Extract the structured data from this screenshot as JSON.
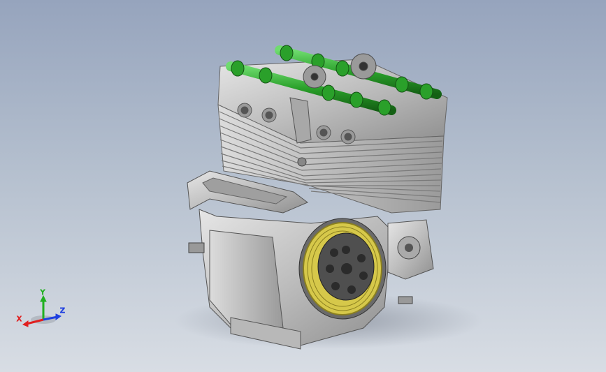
{
  "triad": {
    "x_label": "X",
    "y_label": "Y",
    "z_label": "Z",
    "colors": {
      "x": "#e02020",
      "y": "#20b020",
      "z": "#2040e0"
    }
  },
  "model": {
    "icon": "engine-assembly-icon",
    "colors": {
      "casting": "#c8c8c8",
      "casting_dark": "#8a8a8a",
      "camshaft": "#2fa82f",
      "clutch_ring": "#d6c84a",
      "clutch_hub": "#555555"
    }
  }
}
